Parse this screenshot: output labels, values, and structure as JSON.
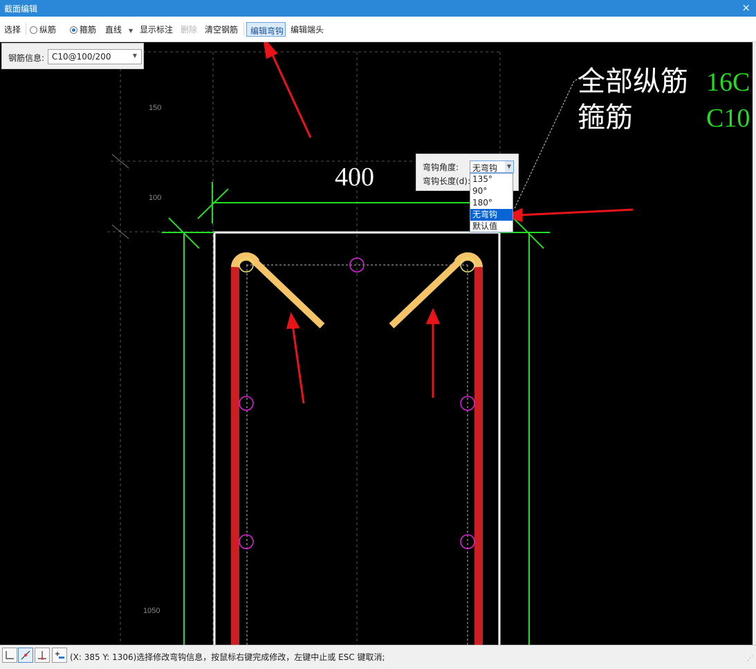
{
  "window": {
    "title": "截面编辑",
    "close_label": "×"
  },
  "toolbar": {
    "select": "选择",
    "longitudinal": "纵筋",
    "stirrup": "箍筋",
    "line_mode": "直线",
    "show_dimension": "显示标注",
    "delete": "删除",
    "clear_rebar": "清空钢筋",
    "edit_hook": "编辑弯钩",
    "edit_end": "编辑端头"
  },
  "rebar_info": {
    "label": "钢筋信息:",
    "value": "C10@100/200"
  },
  "hook_editor": {
    "angle_label": "弯钩角度:",
    "length_label": "弯钩长度(d):",
    "angle_value": "无弯钩",
    "options": [
      "135°",
      "90°",
      "180°",
      "无弯钩",
      "默认值"
    ],
    "selected_option": "无弯钩"
  },
  "drawing": {
    "dimension_width": "400",
    "dim_150": "150",
    "dim_100": "100",
    "dim_1050": "1050",
    "legend_all_longitudinal_label": "全部纵筋",
    "legend_all_longitudinal_value": "16C",
    "legend_stirrup_label": "箍筋",
    "legend_stirrup_value": "C10",
    "colors": {
      "background": "#000000",
      "stirrup": "#cc1f24",
      "hook": "#f5c469",
      "rebar_point": "#e020e0",
      "dimension": "#22dd22",
      "outline": "#ffffff",
      "annotation": "#e8141a"
    }
  },
  "status": {
    "text": "(X: 385 Y: 1306)选择修改弯钩信息，按鼠标右键完成修改，左键中止或 ESC 键取消;"
  }
}
